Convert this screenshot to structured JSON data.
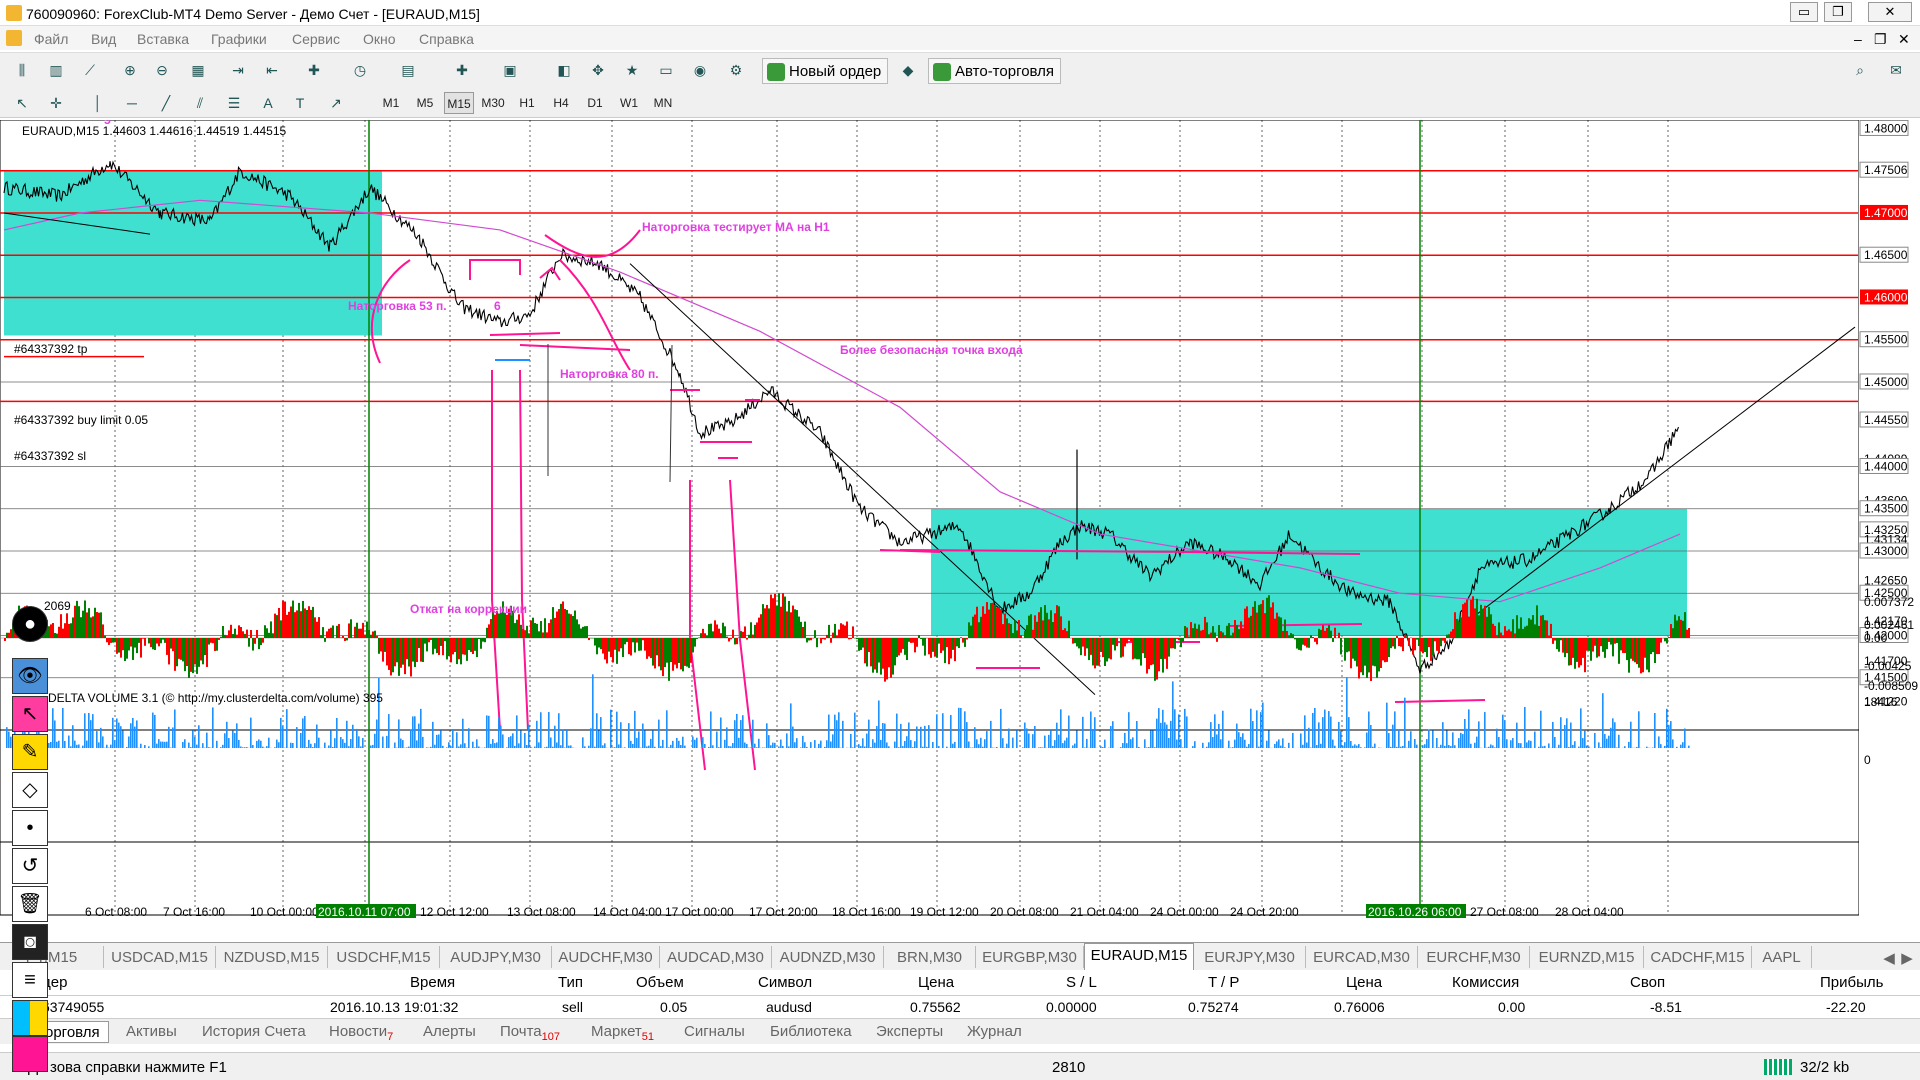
{
  "window": {
    "title": "760090960: ForexClub-MT4 Demo Server - Демо Счет - [EURAUD,M15]",
    "btn_minimize": "▭",
    "btn_restore": "❐",
    "btn_close": "✕"
  },
  "menu": [
    "Файл",
    "Вид",
    "Вставка",
    "Графики",
    "Сервис",
    "Окно",
    "Справка"
  ],
  "menu_right": {
    "min": "–",
    "restore": "❐",
    "close": "✕"
  },
  "toolbar": {
    "new_order": "Новый ордер",
    "auto_trading": "Авто-торговля"
  },
  "timeframes": [
    "M1",
    "M5",
    "M15",
    "M30",
    "H1",
    "H4",
    "D1",
    "W1",
    "MN"
  ],
  "active_timeframe": "M15",
  "chart": {
    "header": "EURAUD,M15  1.44603 1.44616 1.44519 1.44515",
    "price_labels": [
      "1.48000",
      "1.47506",
      "1.47000",
      "1.46500",
      "1.46000",
      "1.45500",
      "1.45000",
      "1.44550",
      "1.44089",
      "1.44000",
      "1.43600",
      "1.43500",
      "1.43250",
      "1.43134",
      "1.43000",
      "1.42650",
      "1.42500",
      "1.42170",
      "1.42000",
      "1.41700",
      "1.41500",
      "1.41220"
    ],
    "red_levels": [
      "1.47000",
      "1.46000"
    ],
    "order_lines": [
      "#64337392 tp",
      "#64337392 buy limit 0.05",
      "#64337392 sl"
    ],
    "annotations": [
      "Наторговка тестирует МА на Н1",
      "Наторговка 53 п.",
      "6",
      "5",
      "Наторговка 80 п.",
      "Более безопасная точка входа",
      "Откат на коррекции"
    ],
    "indicator1": {
      "label": "2069",
      "scale": [
        "0.007372",
        "0.002461",
        "0.00",
        "-0.00425",
        "-0.008509"
      ]
    },
    "indicator2": {
      "label": "DELTA VOLUME 3.1 (© http://my.clusterdelta.com/volume) 395",
      "scale": [
        "18416",
        "0"
      ]
    },
    "time_labels": [
      "6 Oct 08:00",
      "7 Oct 16:00",
      "10 Oct 00:00",
      "2016.10.11 07:00",
      "12 Oct 12:00",
      "13 Oct 08:00",
      "14 Oct 04:00",
      "17 Oct 00:00",
      "17 Oct 20:00",
      "18 Oct 16:00",
      "19 Oct 12:00",
      "20 Oct 08:00",
      "21 Oct 04:00",
      "24 Oct 00:00",
      "24 Oct 20:00",
      "2016.10.26 06:00",
      "27 Oct 08:00",
      "28 Oct 04:00"
    ],
    "left_time_fragment": "16"
  },
  "symbol_tabs": [
    "PY,M15",
    "USDCAD,M15",
    "NZDUSD,M15",
    "USDCHF,M15",
    "AUDJPY,M30",
    "AUDCHF,M30",
    "AUDCAD,M30",
    "AUDNZD,M30",
    "BRN,M30",
    "EURGBP,M30",
    "EURAUD,M15",
    "EURJPY,M30",
    "EURCAD,M30",
    "EURCHF,M30",
    "EURNZD,M15",
    "CADCHF,M15",
    "AAPL"
  ],
  "active_symbol_tab": "EURAUD,M15",
  "terminal": {
    "headers": [
      "дер",
      "Время",
      "Тип",
      "Объем",
      "Символ",
      "Цена",
      "S / L",
      "T / P",
      "Цена",
      "Комиссия",
      "Своп",
      "Прибыль"
    ],
    "row": [
      "63749055",
      "2016.10.13 19:01:32",
      "sell",
      "0.05",
      "audusd",
      "0.75562",
      "0.00000",
      "0.75274",
      "0.76006",
      "0.00",
      "-8.51",
      "-22.20"
    ]
  },
  "bottom_tabs": [
    {
      "label": "орговля"
    },
    {
      "label": "Активы"
    },
    {
      "label": "История Счета"
    },
    {
      "label": "Новости",
      "badge": "7"
    },
    {
      "label": "Алерты"
    },
    {
      "label": "Почта",
      "badge": "107"
    },
    {
      "label": "Маркет",
      "badge": "51"
    },
    {
      "label": "Сигналы"
    },
    {
      "label": "Библиотека"
    },
    {
      "label": "Эксперты"
    },
    {
      "label": "Журнал"
    }
  ],
  "status": {
    "help": "Для вызова справки нажмите F1",
    "help_visible": "зова справки нажмите F1",
    "help_prefix": "Д",
    "bars": "2810",
    "traffic": "32/2 kb"
  },
  "colors": {
    "red_line": "#ff0000",
    "cyan_zone": "#40e0d0",
    "green_line": "#008000",
    "magenta": "#ff1493",
    "price_tag_red": "#ff0000",
    "ind_green": "#008000",
    "ind_red": "#ff0000",
    "vol_blue": "#1e90ff"
  }
}
